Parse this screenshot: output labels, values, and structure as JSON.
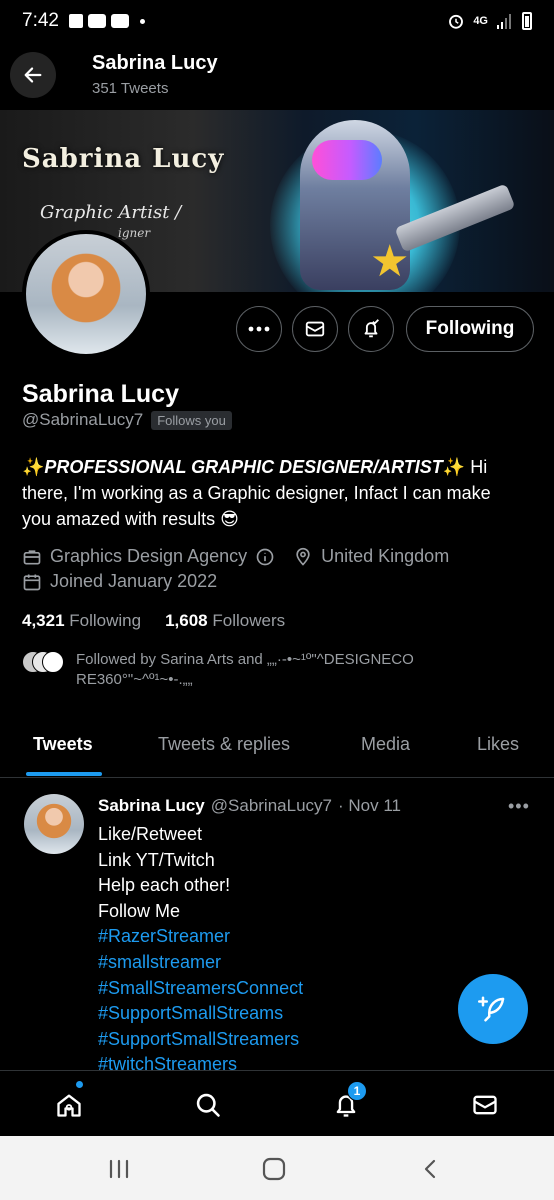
{
  "status_bar": {
    "time": "7:42",
    "network": "4G"
  },
  "header": {
    "name": "Sabrina Lucy",
    "tweet_count": "351 Tweets"
  },
  "banner": {
    "brand_text": "Sabrina Lucy",
    "script_text": "Graphic Artist /",
    "script_text2": "igner"
  },
  "profile": {
    "name": "Sabrina Lucy",
    "handle": "@SabrinaLucy7",
    "follows_you": "Follows you",
    "bio_emoji_start": "✨",
    "bio_bold": "PROFESSIONAL GRAPHIC DESIGNER/ARTIST",
    "bio_emoji_mid": "✨",
    "bio_rest": "Hi there, I'm working as a Graphic designer, Infact I can make you amazed with results 😎",
    "category": "Graphics Design Agency",
    "location": "United Kingdom",
    "joined": "Joined January 2022",
    "following_count": "4,321",
    "following_label": "Following",
    "followers_count": "1,608",
    "followers_label": "Followers",
    "followed_by": "Followed by Sarina Arts and „„·-•~¹º\"^DESIGNECO RE360°\"~^º¹~•-.„„"
  },
  "actions": {
    "following_button": "Following"
  },
  "tabs": [
    {
      "label": "Tweets"
    },
    {
      "label": "Tweets & replies"
    },
    {
      "label": "Media"
    },
    {
      "label": "Likes"
    }
  ],
  "tweet": {
    "name": "Sabrina Lucy",
    "handle": "@SabrinaLucy7",
    "date": "· Nov 11",
    "lines": [
      "Like/Retweet",
      "Link YT/Twitch",
      "Help each other!",
      "Follow Me"
    ],
    "hashtags": [
      "#RazerStreamer",
      "#smallstreamer",
      "#SmallStreamersConnect",
      "#SupportSmallStreams",
      "#SupportSmallStreamers",
      "#twitchStreamers"
    ]
  },
  "bottom_nav": {
    "notification_count": "1"
  },
  "colors": {
    "accent": "#1d9bf0",
    "background": "#000000",
    "secondary_text": "#9a9ea3"
  }
}
